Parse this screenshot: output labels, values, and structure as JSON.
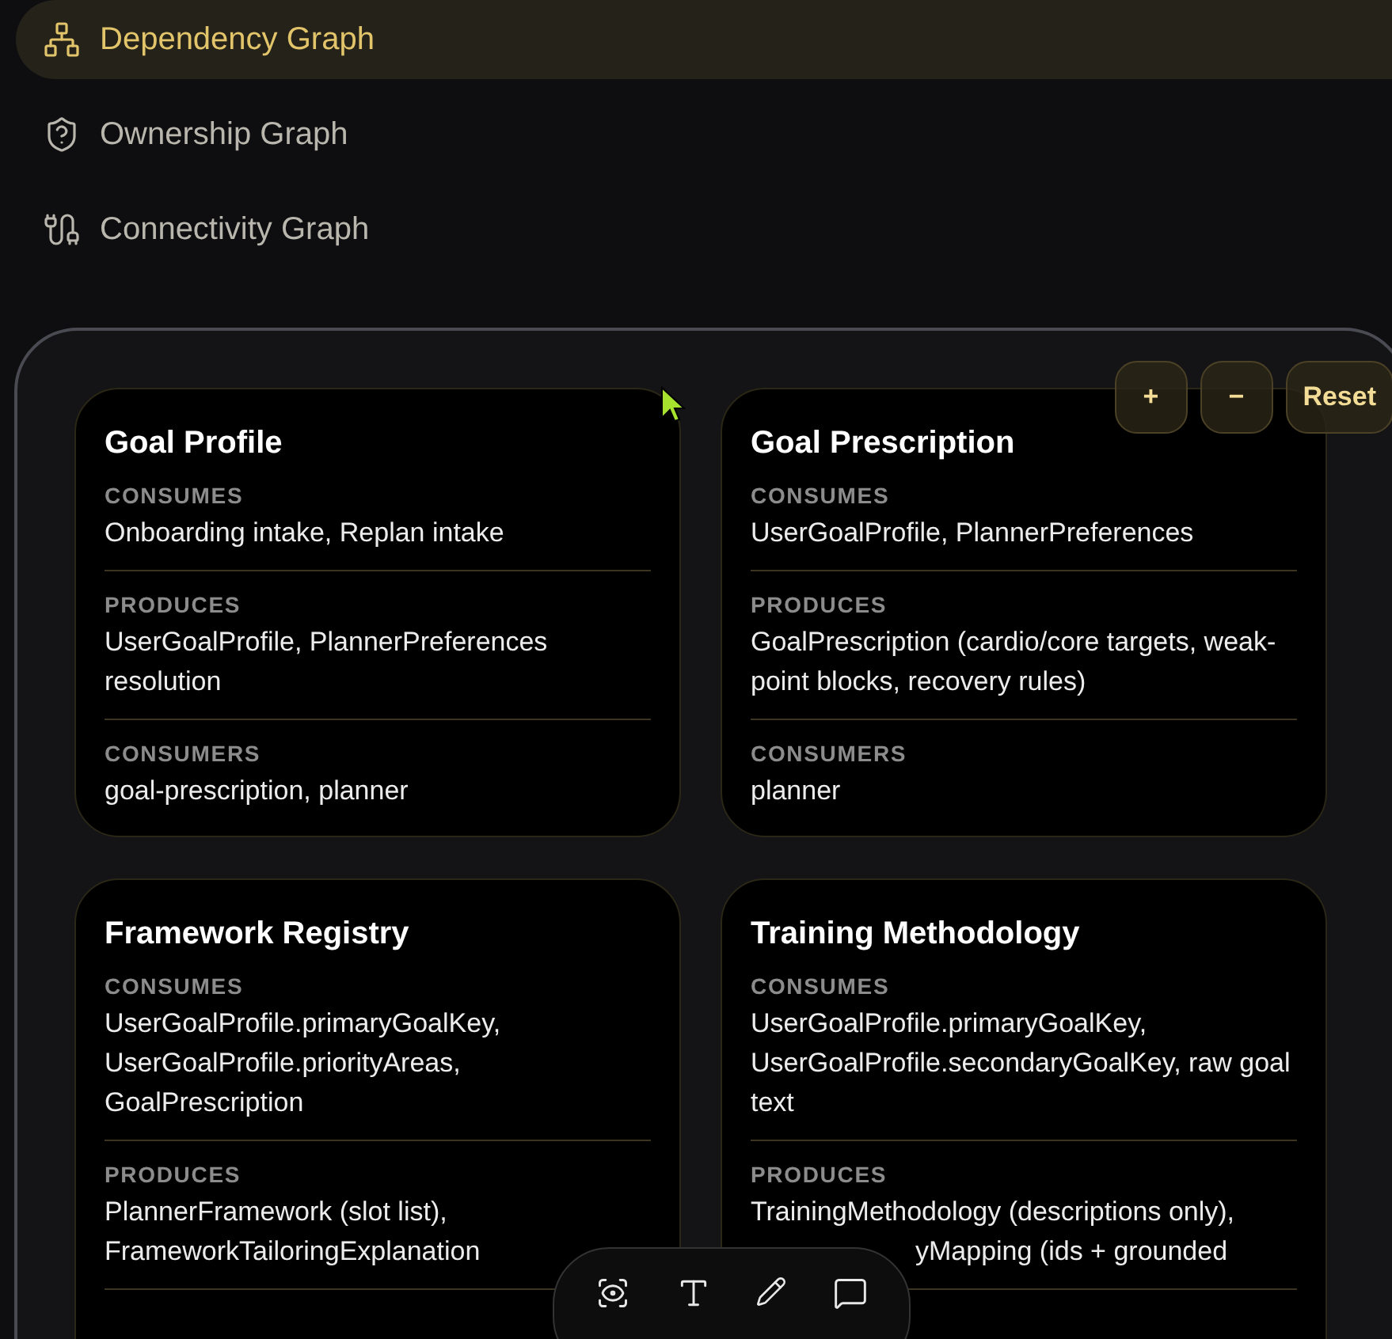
{
  "nav": [
    {
      "label": "Dependency Graph",
      "selected": true
    },
    {
      "label": "Ownership Graph",
      "selected": false
    },
    {
      "label": "Connectivity Graph",
      "selected": false
    }
  ],
  "zoom_controls": [
    "+",
    "−",
    "Reset"
  ],
  "cards": [
    {
      "title": "Goal Profile",
      "cut_off": false,
      "sections": [
        {
          "label": "CONSUMES",
          "value": "Onboarding intake, Replan intake"
        },
        {
          "label": "PRODUCES",
          "value": "UserGoalProfile, PlannerPreferences resolution"
        },
        {
          "label": "CONSUMERS",
          "value": "goal-prescription, planner"
        }
      ]
    },
    {
      "title": "Goal Prescription",
      "cut_off": false,
      "sections": [
        {
          "label": "CONSUMES",
          "value": "UserGoalProfile, PlannerPreferences"
        },
        {
          "label": "PRODUCES",
          "value": "GoalPrescription (cardio/core targets, weak-point blocks, recovery rules)"
        },
        {
          "label": "CONSUMERS",
          "value": "planner"
        }
      ]
    },
    {
      "title": "Framework Registry",
      "cut_off": true,
      "sections": [
        {
          "label": "CONSUMES",
          "value": "UserGoalProfile.primaryGoalKey, UserGoalProfile.priorityAreas, GoalPrescription"
        },
        {
          "label": "PRODUCES",
          "value": "PlannerFramework (slot list), FrameworkTailoringExplanation"
        }
      ]
    },
    {
      "title": "Training Methodology",
      "cut_off": true,
      "sections": [
        {
          "label": "CONSUMES",
          "value": "UserGoalProfile.primaryGoalKey, UserGoalProfile.secondaryGoalKey, raw goal text"
        },
        {
          "label": "PRODUCES",
          "value": "TrainingMethodology (descriptions only),",
          "fragment": "yMapping (ids + grounded"
        }
      ]
    }
  ]
}
